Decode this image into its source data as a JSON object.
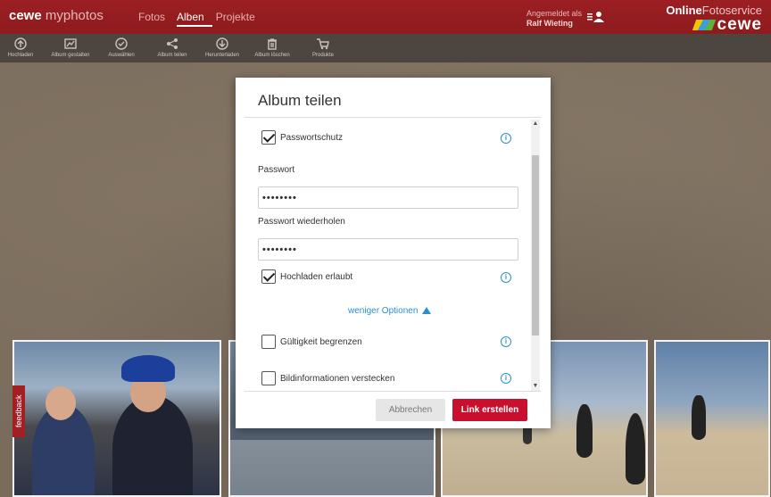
{
  "header": {
    "brand_bold": "cewe",
    "brand_rest": " myphotos",
    "tabs": [
      {
        "label": "Fotos",
        "active": false
      },
      {
        "label": "Alben",
        "active": true
      },
      {
        "label": "Projekte",
        "active": false
      }
    ],
    "user_prefix": "Angemeldet als",
    "user_name": "Ralf Wieting",
    "logo_line1_bold": "Online",
    "logo_line1_rest": "Fotoservice",
    "logo_line2": "cewe"
  },
  "toolbar": {
    "items": [
      {
        "label": "Hochladen",
        "icon": "upload-icon"
      },
      {
        "label": "Album gestalten",
        "icon": "album-design-icon"
      },
      {
        "label": "Auswählen",
        "icon": "select-icon"
      },
      {
        "label": "Album teilen",
        "icon": "share-icon"
      },
      {
        "label": "Herunterladen",
        "icon": "download-icon"
      },
      {
        "label": "Album löschen",
        "icon": "trash-icon"
      },
      {
        "label": "Produkte",
        "icon": "cart-icon"
      }
    ]
  },
  "dialog": {
    "title": "Album teilen",
    "password_protection": {
      "label": "Passwortschutz",
      "checked": true
    },
    "password_label": "Passwort",
    "password_value": "••••••••",
    "password_repeat_label": "Passwort wiederholen",
    "password_repeat_value": "••••••••",
    "upload_allowed": {
      "label": "Hochladen erlaubt",
      "checked": true
    },
    "fewer_options": "weniger Optionen",
    "limit_validity": {
      "label": "Gültigkeit begrenzen",
      "checked": false
    },
    "hide_info": {
      "label": "Bildinformationen verstecken",
      "checked": false
    },
    "info_symbol": "i",
    "cancel_label": "Abbrechen",
    "create_label": "Link erstellen"
  },
  "feedback_label": "feedback",
  "colors": {
    "brand_red": "#9b1f22",
    "button_red": "#c8102e",
    "link_blue": "#2a8fd0"
  }
}
